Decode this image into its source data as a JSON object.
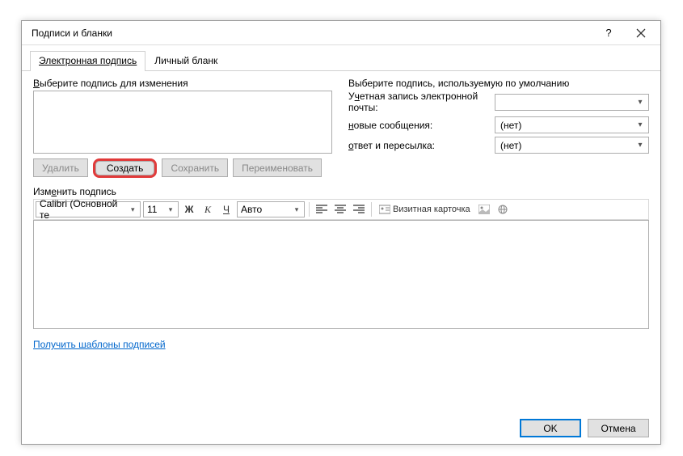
{
  "title": "Подписи и бланки",
  "tabs": {
    "digital": "Электронная подпись",
    "letterhead": "Личный бланк"
  },
  "left": {
    "chooseLabel": "Выберите подпись для изменения",
    "delete": "Удалить",
    "create": "Создать",
    "save": "Сохранить",
    "rename": "Переименовать"
  },
  "right": {
    "defaultLabel": "Выберите подпись, используемую по умолчанию",
    "account": "Учетная запись электронной почты:",
    "accountValue": "",
    "newMsg": "новые сообщения:",
    "newMsgValue": "(нет)",
    "reply": "ответ и пересылка:",
    "replyValue": "(нет)"
  },
  "edit": {
    "label": "Изменить подпись",
    "font": "Calibri (Основной те",
    "size": "11",
    "auto": "Авто",
    "card": "Визитная карточка"
  },
  "templatesLink": "Получить шаблоны подписей",
  "ok": "OK",
  "cancel": "Отмена"
}
